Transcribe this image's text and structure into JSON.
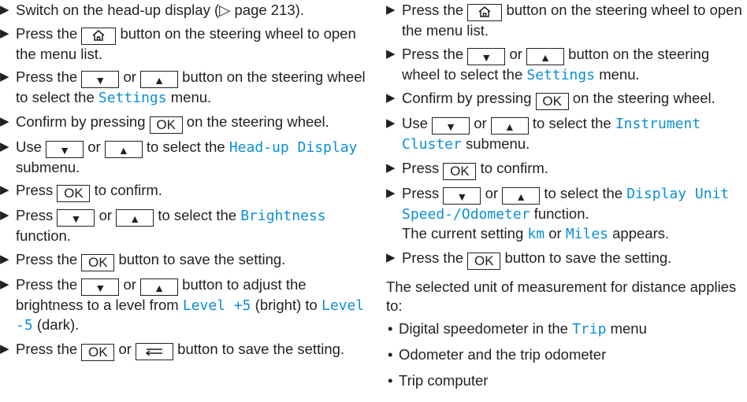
{
  "left_column": {
    "step1": {
      "text": "Switch on the head-up display (",
      "ref": "▷ page 213",
      "end": ")."
    },
    "step2": {
      "a": "Press the",
      "b": "button on the steering wheel to open the menu list."
    },
    "step3": {
      "a": "Press the",
      "or": "or",
      "b": "button on the steering wheel to select the",
      "highlight": "Settings",
      "c": "menu."
    },
    "step4": {
      "a": "Confirm by pressing",
      "ok": "OK",
      "b": "on the steering wheel."
    },
    "step5": {
      "a": "Use",
      "or": "or",
      "b": "to select the",
      "highlight": "Head-up Display",
      "c": "submenu."
    },
    "step6": {
      "a": "Press",
      "ok": "OK",
      "b": "to confirm."
    },
    "step7": {
      "a": "Press",
      "or": "or",
      "b": "to select the",
      "highlight": "Brightness",
      "c": "function."
    },
    "step8": {
      "a": "Press the",
      "ok": "OK",
      "b": "button to save the setting."
    },
    "step9": {
      "a": "Press the",
      "or": "or",
      "b": "button to adjust the brightness to a level from",
      "level1": "Level +5",
      "c": "(bright) to",
      "level2": "Level -5",
      "d": "(dark)."
    },
    "step10": {
      "a": "Press the",
      "ok": "OK",
      "or": "or",
      "b": "button to save the setting."
    }
  },
  "right_column": {
    "step1": {
      "a": "Press the",
      "b": "button on the steering wheel to open the menu list."
    },
    "step2": {
      "a": "Press the",
      "or": "or",
      "b": "button on the steering wheel to select the",
      "highlight": "Settings",
      "c": "menu."
    },
    "step3": {
      "a": "Confirm by pressing",
      "ok": "OK",
      "b": "on the steering wheel."
    },
    "step4": {
      "a": "Use",
      "or": "or",
      "b": "to select the",
      "highlight": "Instrument Cluster",
      "c": "submenu."
    },
    "step5": {
      "a": "Press",
      "ok": "OK",
      "b": "to confirm."
    },
    "step6": {
      "a": "Press",
      "or": "or",
      "b": "to select the",
      "highlight": "Display Unit Speed-/Odometer",
      "c": "function.",
      "d": "The current setting",
      "km": "km",
      "e": "or",
      "miles": "Miles",
      "f": "appears."
    },
    "step7": {
      "a": "Press the",
      "ok": "OK",
      "b": "button to save the setting."
    },
    "note": "The selected unit of measurement for distance applies to:",
    "bullets": [
      {
        "a": "Digital speedometer in the",
        "highlight": "Trip",
        "b": "menu"
      },
      {
        "a": "Odometer and the trip odometer"
      },
      {
        "a": "Trip computer"
      }
    ]
  },
  "glyphs": {
    "step_marker": "▶",
    "down": "▼",
    "up": "▲",
    "bullet": "•"
  },
  "colors": {
    "highlight": "#0b8fd6",
    "text": "#231f20"
  },
  "icons": [
    "home-icon",
    "back-icon",
    "down-arrow-icon",
    "up-arrow-icon"
  ]
}
